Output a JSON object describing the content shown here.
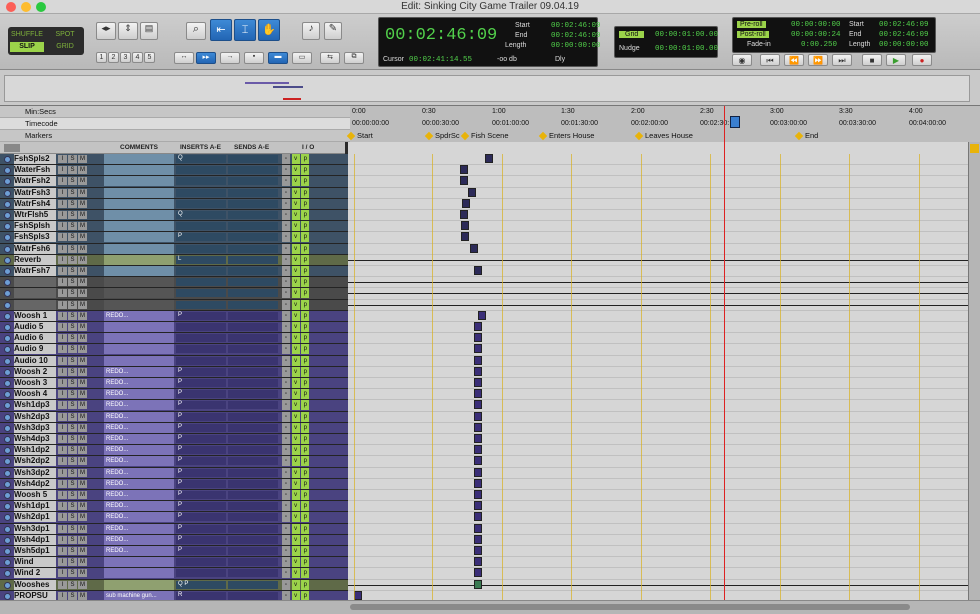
{
  "window": {
    "title": "Edit: Sinking City Game Trailer 09.04.19"
  },
  "modes": {
    "shuffle": "SHUFFLE",
    "spot": "SPOT",
    "slip": "SLIP",
    "grid": "GRID"
  },
  "zoom_presets": [
    "1",
    "2",
    "3",
    "4",
    "5"
  ],
  "counter": {
    "main": "00:02:46:09",
    "start_label": "Start",
    "end_label": "End",
    "length_label": "Length",
    "start": "00:02:46:09",
    "end": "00:02:46:09",
    "length": "00:00:00:00",
    "cursor_label": "Cursor",
    "cursor": "00:02:41:14.55",
    "db": "-oo db",
    "dly": "Dly"
  },
  "grid_nudge": {
    "grid_label": "Grid",
    "grid": "00:00:01:00.00",
    "nudge_label": "Nudge",
    "nudge": "00:00:01:00.00"
  },
  "transport_counter": {
    "preroll_label": "Pre-roll",
    "preroll": "00:00:00:00",
    "postroll_label": "Post-roll",
    "postroll": "00:00:00:24",
    "fadein_label": "Fade-in",
    "fadein": "0:00.250",
    "start_label": "Start",
    "start": "00:02:46:09",
    "end_label": "End",
    "end": "00:02:46:09",
    "length_label": "Length",
    "length": "00:00:00:00"
  },
  "rulers": {
    "minsecs": "Min:Secs",
    "timecode": "Timecode",
    "markers": "Markers"
  },
  "minsec_ticks": [
    "0:00",
    "0:30",
    "1:00",
    "1:30",
    "2:00",
    "2:30",
    "3:00",
    "3:30",
    "4:00"
  ],
  "timecode_ticks": [
    "00:00:00:00",
    "00:00:30:00",
    "00:01:00:00",
    "00:01:30:00",
    "00:02:00:00",
    "00:02:30:",
    "00:03:00:00",
    "00:03:30:00",
    "00:04:00:00"
  ],
  "markers": [
    "Start",
    "SpdrSc",
    "Fish Scene",
    "Enters House",
    "Leaves House",
    "End"
  ],
  "columns": {
    "comments": "COMMENTS",
    "inserts": "INSERTS A-E",
    "sends": "SENDS A-E",
    "io": "I / O"
  },
  "tracks": [
    {
      "name": "FshSpls2",
      "comment": "",
      "color": "#6f8fa8",
      "ins": "Q",
      "cls": "blue"
    },
    {
      "name": "WaterFsh",
      "comment": "",
      "color": "#6f8fa8",
      "ins": "",
      "cls": "blue"
    },
    {
      "name": "WatrFsh2",
      "comment": "",
      "color": "#6f8fa8",
      "ins": "",
      "cls": "blue"
    },
    {
      "name": "WatrFsh3",
      "comment": "",
      "color": "#6f8fa8",
      "ins": "",
      "cls": "blue"
    },
    {
      "name": "WatrFsh4",
      "comment": "",
      "color": "#6f8fa8",
      "ins": "",
      "cls": "blue"
    },
    {
      "name": "WtrFlsh5",
      "comment": "",
      "color": "#6f8fa8",
      "ins": "Q",
      "cls": "blue"
    },
    {
      "name": "FshSplsh",
      "comment": "",
      "color": "#6f8fa8",
      "ins": "",
      "cls": "blue"
    },
    {
      "name": "FshSpls3",
      "comment": "",
      "color": "#6f8fa8",
      "ins": "P",
      "cls": "blue"
    },
    {
      "name": "WatrFsh6",
      "comment": "",
      "color": "#6f8fa8",
      "ins": "",
      "cls": "blue"
    },
    {
      "name": "Reverb",
      "comment": "",
      "color": "#8fa070",
      "ins": "L",
      "cls": "green"
    },
    {
      "name": "WatrFsh7",
      "comment": "",
      "color": "#6f8fa8",
      "ins": "",
      "cls": "blue"
    },
    {
      "name": "",
      "comment": "",
      "color": "#555555",
      "ins": "",
      "cls": "gray"
    },
    {
      "name": "",
      "comment": "",
      "color": "#555555",
      "ins": "",
      "cls": "gray"
    },
    {
      "name": "",
      "comment": "",
      "color": "#555555",
      "ins": "",
      "cls": "gray"
    },
    {
      "name": "Woosh 1",
      "comment": "REDO...",
      "color": "#7c73b8",
      "ins": "P",
      "cls": "purple"
    },
    {
      "name": "Audio 5",
      "comment": "",
      "color": "#7c73b8",
      "ins": "",
      "cls": "purple"
    },
    {
      "name": "Audio 6",
      "comment": "",
      "color": "#7c73b8",
      "ins": "",
      "cls": "purple"
    },
    {
      "name": "Audio 9",
      "comment": "",
      "color": "#7c73b8",
      "ins": "",
      "cls": "purple"
    },
    {
      "name": "Audio 10",
      "comment": "",
      "color": "#7c73b8",
      "ins": "",
      "cls": "purple"
    },
    {
      "name": "Woosh 2",
      "comment": "REDO...",
      "color": "#7c73b8",
      "ins": "P",
      "cls": "purple"
    },
    {
      "name": "Woosh 3",
      "comment": "REDO...",
      "color": "#7c73b8",
      "ins": "P",
      "cls": "purple"
    },
    {
      "name": "Woosh 4",
      "comment": "REDO...",
      "color": "#7c73b8",
      "ins": "P",
      "cls": "purple"
    },
    {
      "name": "Wsh1dp3",
      "comment": "REDO...",
      "color": "#7c73b8",
      "ins": "P",
      "cls": "purple"
    },
    {
      "name": "Wsh2dp3",
      "comment": "REDO...",
      "color": "#7c73b8",
      "ins": "P",
      "cls": "purple"
    },
    {
      "name": "Wsh3dp3",
      "comment": "REDO...",
      "color": "#7c73b8",
      "ins": "P",
      "cls": "purple"
    },
    {
      "name": "Wsh4dp3",
      "comment": "REDO...",
      "color": "#7c73b8",
      "ins": "P",
      "cls": "purple"
    },
    {
      "name": "Wsh1dp2",
      "comment": "REDO...",
      "color": "#7c73b8",
      "ins": "P",
      "cls": "purple"
    },
    {
      "name": "Wsh2dp2",
      "comment": "REDO...",
      "color": "#7c73b8",
      "ins": "P",
      "cls": "purple"
    },
    {
      "name": "Wsh3dp2",
      "comment": "REDO...",
      "color": "#7c73b8",
      "ins": "P",
      "cls": "purple"
    },
    {
      "name": "Wsh4dp2",
      "comment": "REDO...",
      "color": "#7c73b8",
      "ins": "P",
      "cls": "purple"
    },
    {
      "name": "Woosh 5",
      "comment": "REDO...",
      "color": "#7c73b8",
      "ins": "P",
      "cls": "purple"
    },
    {
      "name": "Wsh1dp1",
      "comment": "REDO...",
      "color": "#7c73b8",
      "ins": "P",
      "cls": "purple"
    },
    {
      "name": "Wsh2dp1",
      "comment": "REDO...",
      "color": "#7c73b8",
      "ins": "P",
      "cls": "purple"
    },
    {
      "name": "Wsh3dp1",
      "comment": "REDO...",
      "color": "#7c73b8",
      "ins": "P",
      "cls": "purple"
    },
    {
      "name": "Wsh4dp1",
      "comment": "REDO...",
      "color": "#7c73b8",
      "ins": "P",
      "cls": "purple"
    },
    {
      "name": "Wsh5dp1",
      "comment": "REDO...",
      "color": "#7c73b8",
      "ins": "P",
      "cls": "purple"
    },
    {
      "name": "Wind",
      "comment": "",
      "color": "#7c73b8",
      "ins": "",
      "cls": "purple"
    },
    {
      "name": "Wind 2",
      "comment": "",
      "color": "#7c73b8",
      "ins": "",
      "cls": "purple"
    },
    {
      "name": "Wooshes",
      "comment": "",
      "color": "#8fa070",
      "ins": "Q P",
      "cls": "green"
    },
    {
      "name": "PROPSU",
      "comment": "sub machine gun...",
      "color": "#7c73b8",
      "ins": "R",
      "cls": "purple"
    }
  ],
  "colors": {
    "counter_green": "#52d14b",
    "selected_blue": "#2265b4",
    "marker": "#e8b30a"
  }
}
